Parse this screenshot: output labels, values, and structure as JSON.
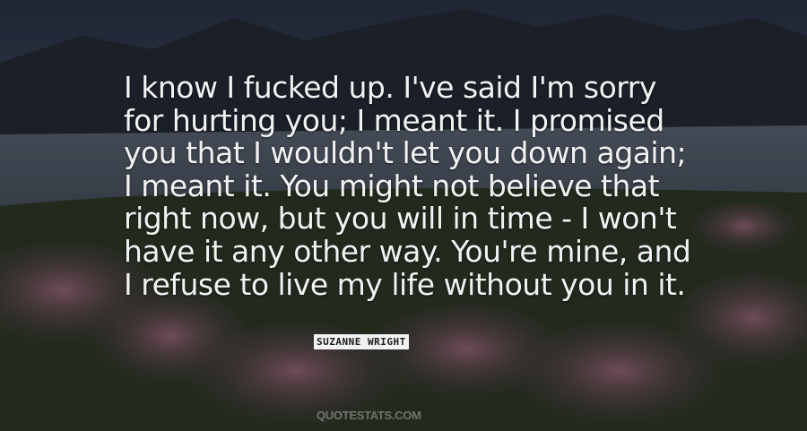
{
  "quote": {
    "text": "I know I fucked up. I've said I'm sorry\nfor hurting you; I meant it. I promised\nyou that I wouldn't let you down again;\nI meant it. You might not believe that\nright now, but you will in time -  I won't\nhave it any other way. You're mine, and\nI refuse to live my life without you in it.",
    "author": "SUZANNE WRIGHT",
    "site": "QUOTESTATS.COM"
  }
}
